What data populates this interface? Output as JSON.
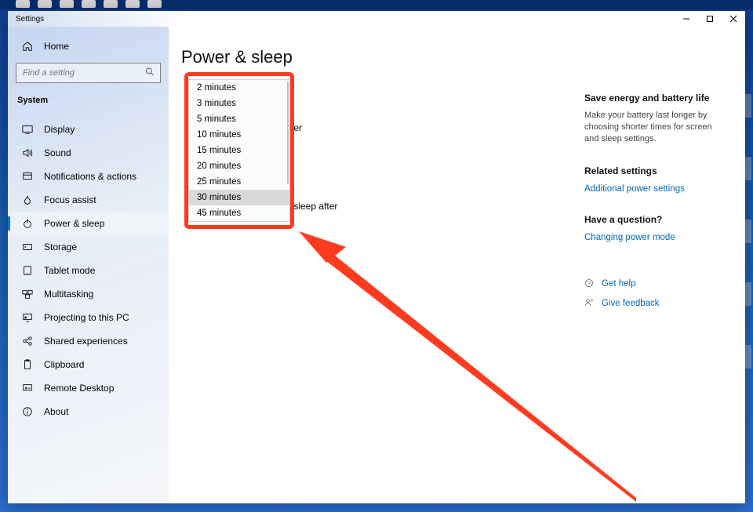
{
  "window": {
    "title": "Settings"
  },
  "sidebar": {
    "home_label": "Home",
    "search_placeholder": "Find a setting",
    "section_label": "System",
    "items": [
      {
        "label": "Display"
      },
      {
        "label": "Sound"
      },
      {
        "label": "Notifications & actions"
      },
      {
        "label": "Focus assist"
      },
      {
        "label": "Power & sleep"
      },
      {
        "label": "Storage"
      },
      {
        "label": "Tablet mode"
      },
      {
        "label": "Multitasking"
      },
      {
        "label": "Projecting to this PC"
      },
      {
        "label": "Shared experiences"
      },
      {
        "label": "Clipboard"
      },
      {
        "label": "Remote Desktop"
      },
      {
        "label": "About"
      }
    ]
  },
  "page": {
    "title": "Power & sleep",
    "line1_tail": "after",
    "line2_tail": "to sleep after"
  },
  "dropdown": {
    "options": [
      "2 minutes",
      "3 minutes",
      "5 minutes",
      "10 minutes",
      "15 minutes",
      "20 minutes",
      "25 minutes",
      "30 minutes",
      "45 minutes"
    ],
    "selected_index": 7
  },
  "right": {
    "energy_title": "Save energy and battery life",
    "energy_body": "Make your battery last longer by choosing shorter times for screen and sleep settings.",
    "related_title": "Related settings",
    "related_link": "Additional power settings",
    "question_title": "Have a question?",
    "question_link": "Changing power mode",
    "help_label": "Get help",
    "feedback_label": "Give feedback"
  }
}
